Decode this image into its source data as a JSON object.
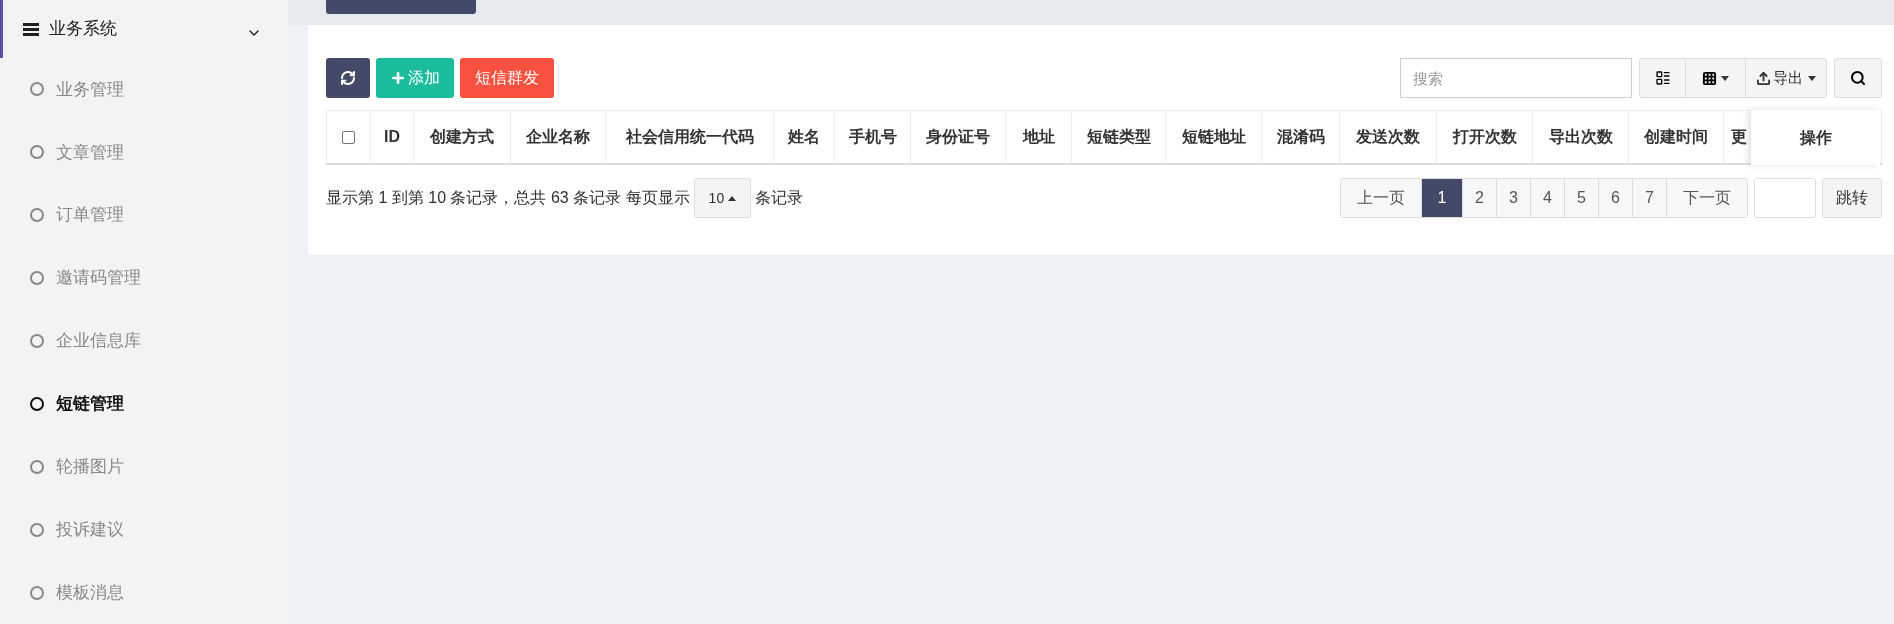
{
  "sidebar": {
    "group": {
      "label": "业务系统",
      "expanded": true
    },
    "items": [
      {
        "label": "业务管理",
        "selected": false
      },
      {
        "label": "文章管理",
        "selected": false
      },
      {
        "label": "订单管理",
        "selected": false
      },
      {
        "label": "邀请码管理",
        "selected": false
      },
      {
        "label": "企业信息库",
        "selected": false
      },
      {
        "label": "短链管理",
        "selected": true
      },
      {
        "label": "轮播图片",
        "selected": false
      },
      {
        "label": "投诉建议",
        "selected": false
      },
      {
        "label": "模板消息",
        "selected": false
      }
    ]
  },
  "toolbar": {
    "add": "添加",
    "sms": "短信群发",
    "search": {
      "placeholder": "搜索"
    },
    "export": "导出"
  },
  "table": {
    "columns": [
      "ID",
      "创建方式",
      "企业名称",
      "社会信用统一代码",
      "姓名",
      "手机号",
      "身份证号",
      "地址",
      "短链类型",
      "短链地址",
      "混淆码",
      "发送次数",
      "打开次数",
      "导出次数",
      "创建时间",
      "更"
    ],
    "fixed_column": "操作",
    "select_all": {
      "checked": false
    }
  },
  "footer": {
    "summary": "显示第 1 到第 10 条记录，总共 63 条记录 每页显示",
    "page_size": "10",
    "suffix": "条记录"
  },
  "pagination": {
    "prev": "上一页",
    "pages": [
      {
        "label": "1",
        "selected": true
      },
      {
        "label": "2",
        "selected": false
      },
      {
        "label": "3",
        "selected": false
      },
      {
        "label": "4",
        "selected": false
      },
      {
        "label": "5",
        "selected": false
      },
      {
        "label": "6",
        "selected": false
      },
      {
        "label": "7",
        "selected": false
      }
    ],
    "next": "下一页",
    "jump": "跳转"
  }
}
